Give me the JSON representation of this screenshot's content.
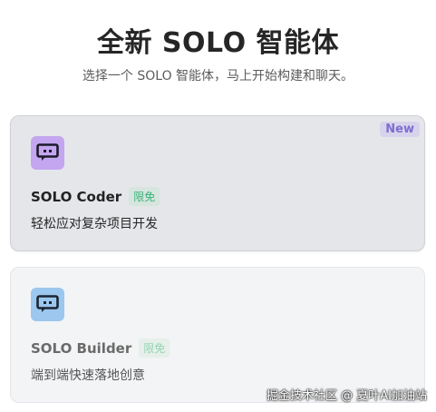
{
  "header": {
    "title": "全新 SOLO 智能体",
    "subtitle": "选择一个 SOLO 智能体，马上开始构建和聊天。"
  },
  "cards": [
    {
      "name": "SOLO Coder",
      "badge": "限免",
      "corner_badge": "New",
      "description": "轻松应对复杂项目开发",
      "icon": "robot-icon",
      "icon_color": "#c4a6f0",
      "selected": true
    },
    {
      "name": "SOLO Builder",
      "badge": "限免",
      "description": "端到端快速落地创意",
      "icon": "robot-icon",
      "icon_color": "#9cc7ee",
      "selected": false
    }
  ],
  "watermark": "掘金技术社区 @ 夏叶AI加油站"
}
